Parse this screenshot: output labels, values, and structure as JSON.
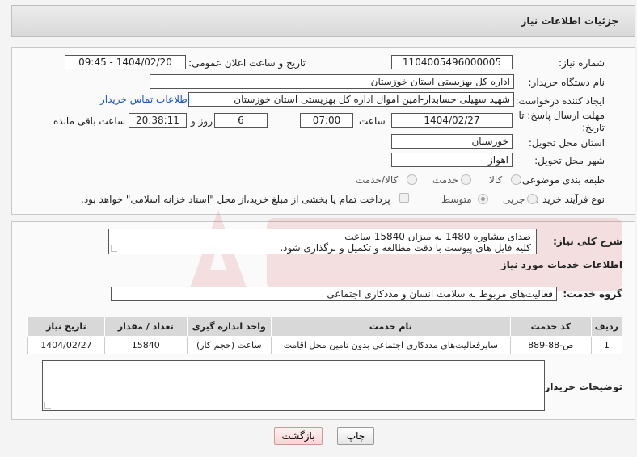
{
  "header": {
    "title": "جزئیات اطلاعات نیاز"
  },
  "fields": {
    "need_number_label": "شماره نیاز:",
    "need_number": "1104005496000005",
    "announce_label": "تاریخ و ساعت اعلان عمومی:",
    "announce_value": "1404/02/20 - 09:45",
    "buyer_org_label": "نام دستگاه خریدار:",
    "buyer_org": "اداره کل بهزیستی استان خوزستان",
    "creator_label": "ایجاد کننده درخواست:",
    "creator": "شهید سهیلی حسابدار-امین اموال اداره کل بهزیستی استان خوزستان",
    "contact_link": "اطلاعات تماس خریدار",
    "deadline_label_1": "مهلت ارسال پاسخ: تا",
    "deadline_label_2": "تاریخ:",
    "deadline_date": "1404/02/27",
    "time_label": "ساعت",
    "deadline_time": "07:00",
    "days_value": "6",
    "days_label": "روز و",
    "remaining_time": "20:38:11",
    "remaining_label": "ساعت باقی مانده",
    "province_label": "استان محل تحویل:",
    "province": "خوزستان",
    "city_label": "شهر محل تحویل:",
    "city": "اهواز",
    "category_label": "طبقه بندی موضوعی:",
    "category_options": [
      "کالا",
      "خدمت",
      "کالا/خدمت"
    ],
    "process_label": "نوع فرآیند خرید :",
    "process_options": [
      "جزیی",
      "متوسط"
    ],
    "payment_note": "پرداخت تمام یا بخشی از مبلغ خرید،از محل \"اسناد خزانه اسلامی\" خواهد بود."
  },
  "description": {
    "label": "شرح کلی نیاز:",
    "line1": "صدای مشاوره 1480 به میزان 15840 ساعت",
    "line2": "کلیه فایل های پیوست با دقت مطالعه و تکمیل و برگذاری شود."
  },
  "services": {
    "section_title": "اطلاعات خدمات مورد نیاز",
    "group_label": "گروه خدمت:",
    "group_value": "فعالیت‌های مربوط به سلامت انسان و مددکاری اجتماعی",
    "headers": [
      "ردیف",
      "کد خدمت",
      "نام خدمت",
      "واحد اندازه گیری",
      "تعداد / مقدار",
      "تاریخ نیاز"
    ],
    "rows": [
      {
        "row": "1",
        "code": "ص-88-889",
        "name": "سایرفعالیت‌های مددکاری اجتماعی بدون تامین محل اقامت",
        "unit": "ساعت (حجم کار)",
        "qty": "15840",
        "date": "1404/02/27"
      }
    ]
  },
  "buyer_notes": {
    "label": "توضیحات خریدار:"
  },
  "buttons": {
    "print": "چاپ",
    "back": "بازگشت"
  }
}
